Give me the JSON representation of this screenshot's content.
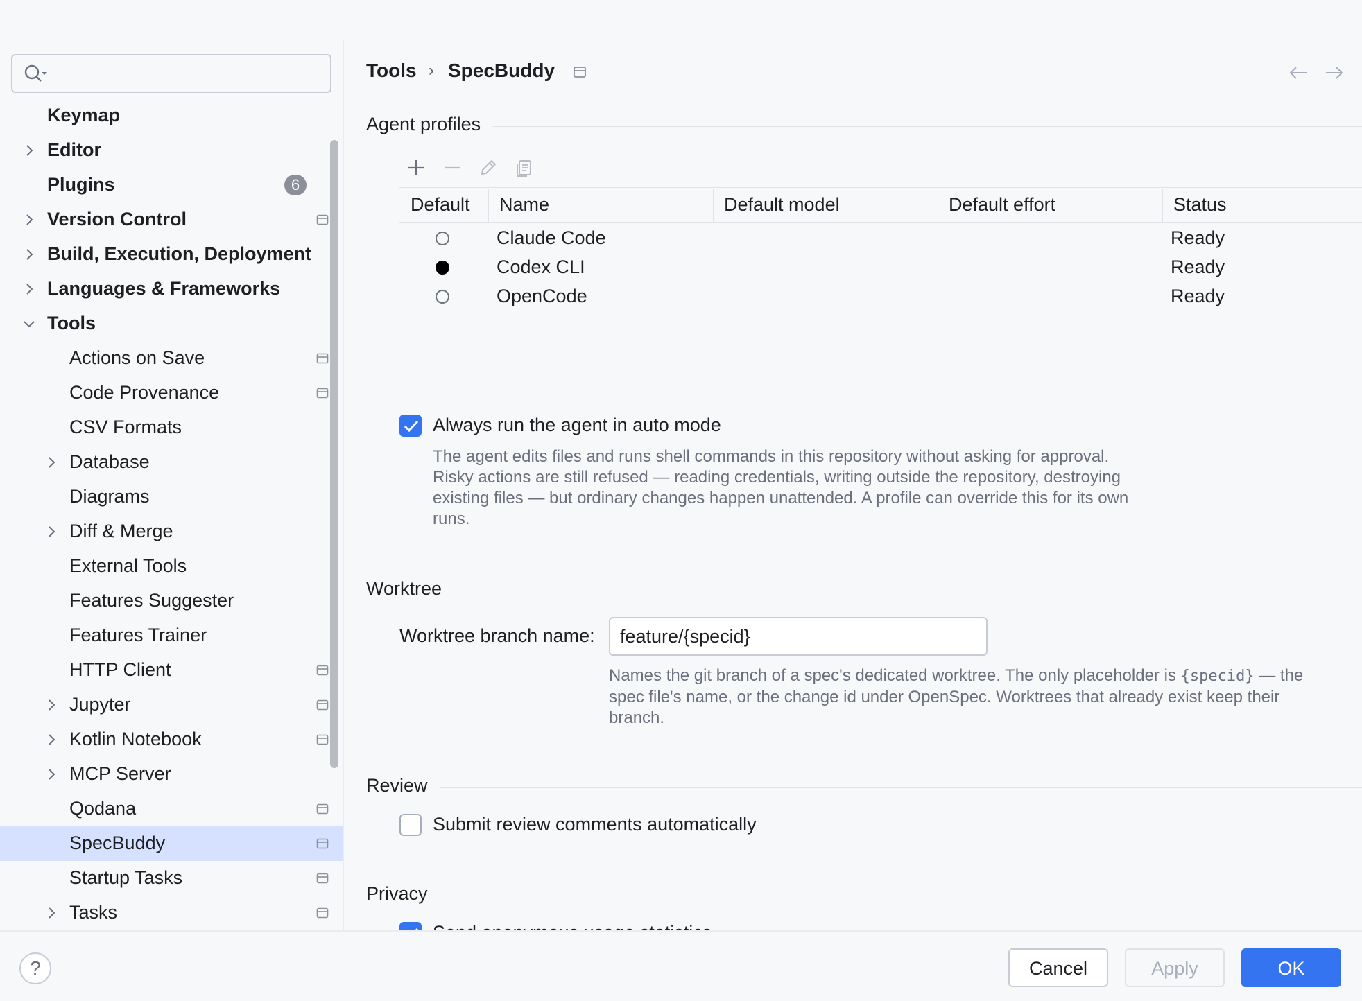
{
  "search": {
    "placeholder": "",
    "value": ""
  },
  "sidebar": {
    "items": [
      {
        "label": "Keymap",
        "bold": true
      },
      {
        "label": "Editor",
        "bold": true,
        "expandable": true
      },
      {
        "label": "Plugins",
        "bold": true,
        "badge": "6"
      },
      {
        "label": "Version Control",
        "bold": true,
        "expandable": true,
        "pinned": true
      },
      {
        "label": "Build, Execution, Deployment",
        "bold": true,
        "expandable": true
      },
      {
        "label": "Languages & Frameworks",
        "bold": true,
        "expandable": true
      },
      {
        "label": "Tools",
        "bold": true,
        "expanded": true
      },
      {
        "label": "Actions on Save",
        "pinned": true
      },
      {
        "label": "Code Provenance",
        "pinned": true
      },
      {
        "label": "CSV Formats"
      },
      {
        "label": "Database",
        "expandable": true
      },
      {
        "label": "Diagrams"
      },
      {
        "label": "Diff & Merge",
        "expandable": true
      },
      {
        "label": "External Tools"
      },
      {
        "label": "Features Suggester"
      },
      {
        "label": "Features Trainer"
      },
      {
        "label": "HTTP Client",
        "pinned": true
      },
      {
        "label": "Jupyter",
        "expandable": true,
        "pinned": true
      },
      {
        "label": "Kotlin Notebook",
        "expandable": true,
        "pinned": true
      },
      {
        "label": "MCP Server",
        "expandable": true
      },
      {
        "label": "Qodana",
        "pinned": true
      },
      {
        "label": "SpecBuddy",
        "pinned": true,
        "selected": true
      },
      {
        "label": "Startup Tasks",
        "pinned": true
      },
      {
        "label": "Tasks",
        "expandable": true,
        "pinned": true
      }
    ]
  },
  "header": {
    "crumb_parent": "Tools",
    "separator": "›",
    "crumb_current": "SpecBuddy"
  },
  "agent_profiles": {
    "title": "Agent profiles",
    "columns": [
      "Default",
      "Name",
      "Default model",
      "Default effort",
      "Status"
    ],
    "rows": [
      {
        "default": false,
        "name": "Claude Code",
        "model": "",
        "effort": "",
        "status": "Ready"
      },
      {
        "default": true,
        "name": "Codex CLI",
        "model": "",
        "effort": "",
        "status": "Ready"
      },
      {
        "default": false,
        "name": "OpenCode",
        "model": "",
        "effort": "",
        "status": "Ready"
      }
    ]
  },
  "auto_mode": {
    "checked": true,
    "label": "Always run the agent in auto mode",
    "hint_lines": [
      "The agent edits files and runs shell commands in this repository without asking for approval.",
      "Risky actions are still refused — reading credentials, writing outside the repository, destroying",
      "existing files — but ordinary changes happen unattended. A profile can override this for its own",
      "runs."
    ]
  },
  "worktree": {
    "title": "Worktree",
    "field_label": "Worktree branch name:",
    "field_value": "feature/{specid}",
    "hint_part1": "Names the git branch of a spec's dedicated worktree. The only placeholder is ",
    "hint_code": "{specid}",
    "hint_part2": " — the",
    "hint_line2": "spec file's name, or the change id under OpenSpec. Worktrees that already exist keep their",
    "hint_line3": "branch."
  },
  "review": {
    "title": "Review",
    "checked": false,
    "label": "Submit review comments automatically"
  },
  "privacy": {
    "title": "Privacy",
    "checked": true,
    "label": "Send anonymous usage statistics"
  },
  "footer": {
    "help": "?",
    "cancel": "Cancel",
    "apply": "Apply",
    "ok": "OK"
  },
  "colors": {
    "accent": "#3574F0",
    "selection": "#D5E1FF",
    "hint_text": "#6C707E"
  }
}
